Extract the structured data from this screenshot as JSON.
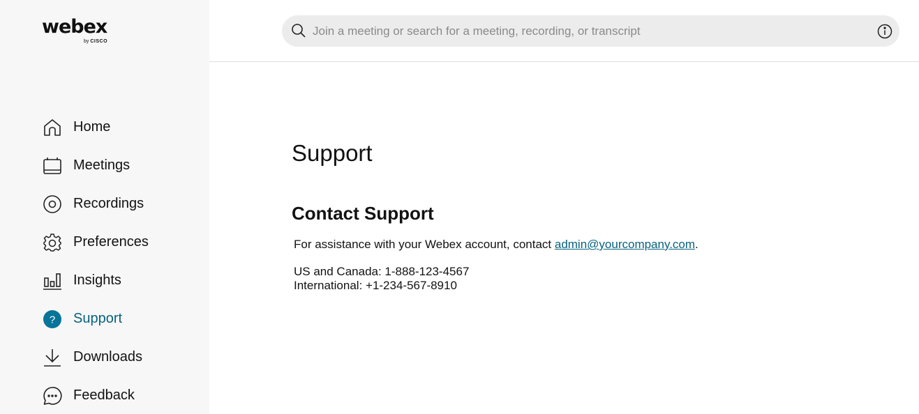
{
  "logo": {
    "word": "webex",
    "by": "by",
    "brand": "CISCO"
  },
  "sidebar": {
    "items": [
      {
        "label": "Home",
        "icon": "home-icon"
      },
      {
        "label": "Meetings",
        "icon": "calendar-icon"
      },
      {
        "label": "Recordings",
        "icon": "recording-icon"
      },
      {
        "label": "Preferences",
        "icon": "gear-icon"
      },
      {
        "label": "Insights",
        "icon": "bar-chart-icon"
      },
      {
        "label": "Support",
        "icon": "help-icon",
        "active": true
      },
      {
        "label": "Downloads",
        "icon": "download-icon"
      },
      {
        "label": "Feedback",
        "icon": "chat-bubble-icon"
      }
    ]
  },
  "search": {
    "placeholder": "Join a meeting or search for a meeting, recording, or transcript",
    "value": ""
  },
  "main": {
    "title": "Support",
    "section_title": "Contact Support",
    "assist_text": "For assistance with your Webex account, contact ",
    "email": "admin@yourcompany.com",
    "assist_suffix": ".",
    "us_canada": "US and Canada: 1-888-123-4567",
    "international": "International: +1-234-567-8910"
  },
  "colors": {
    "accent": "#07627f",
    "sidebar_bg": "#f7f7f7",
    "search_bg": "#ececec"
  }
}
